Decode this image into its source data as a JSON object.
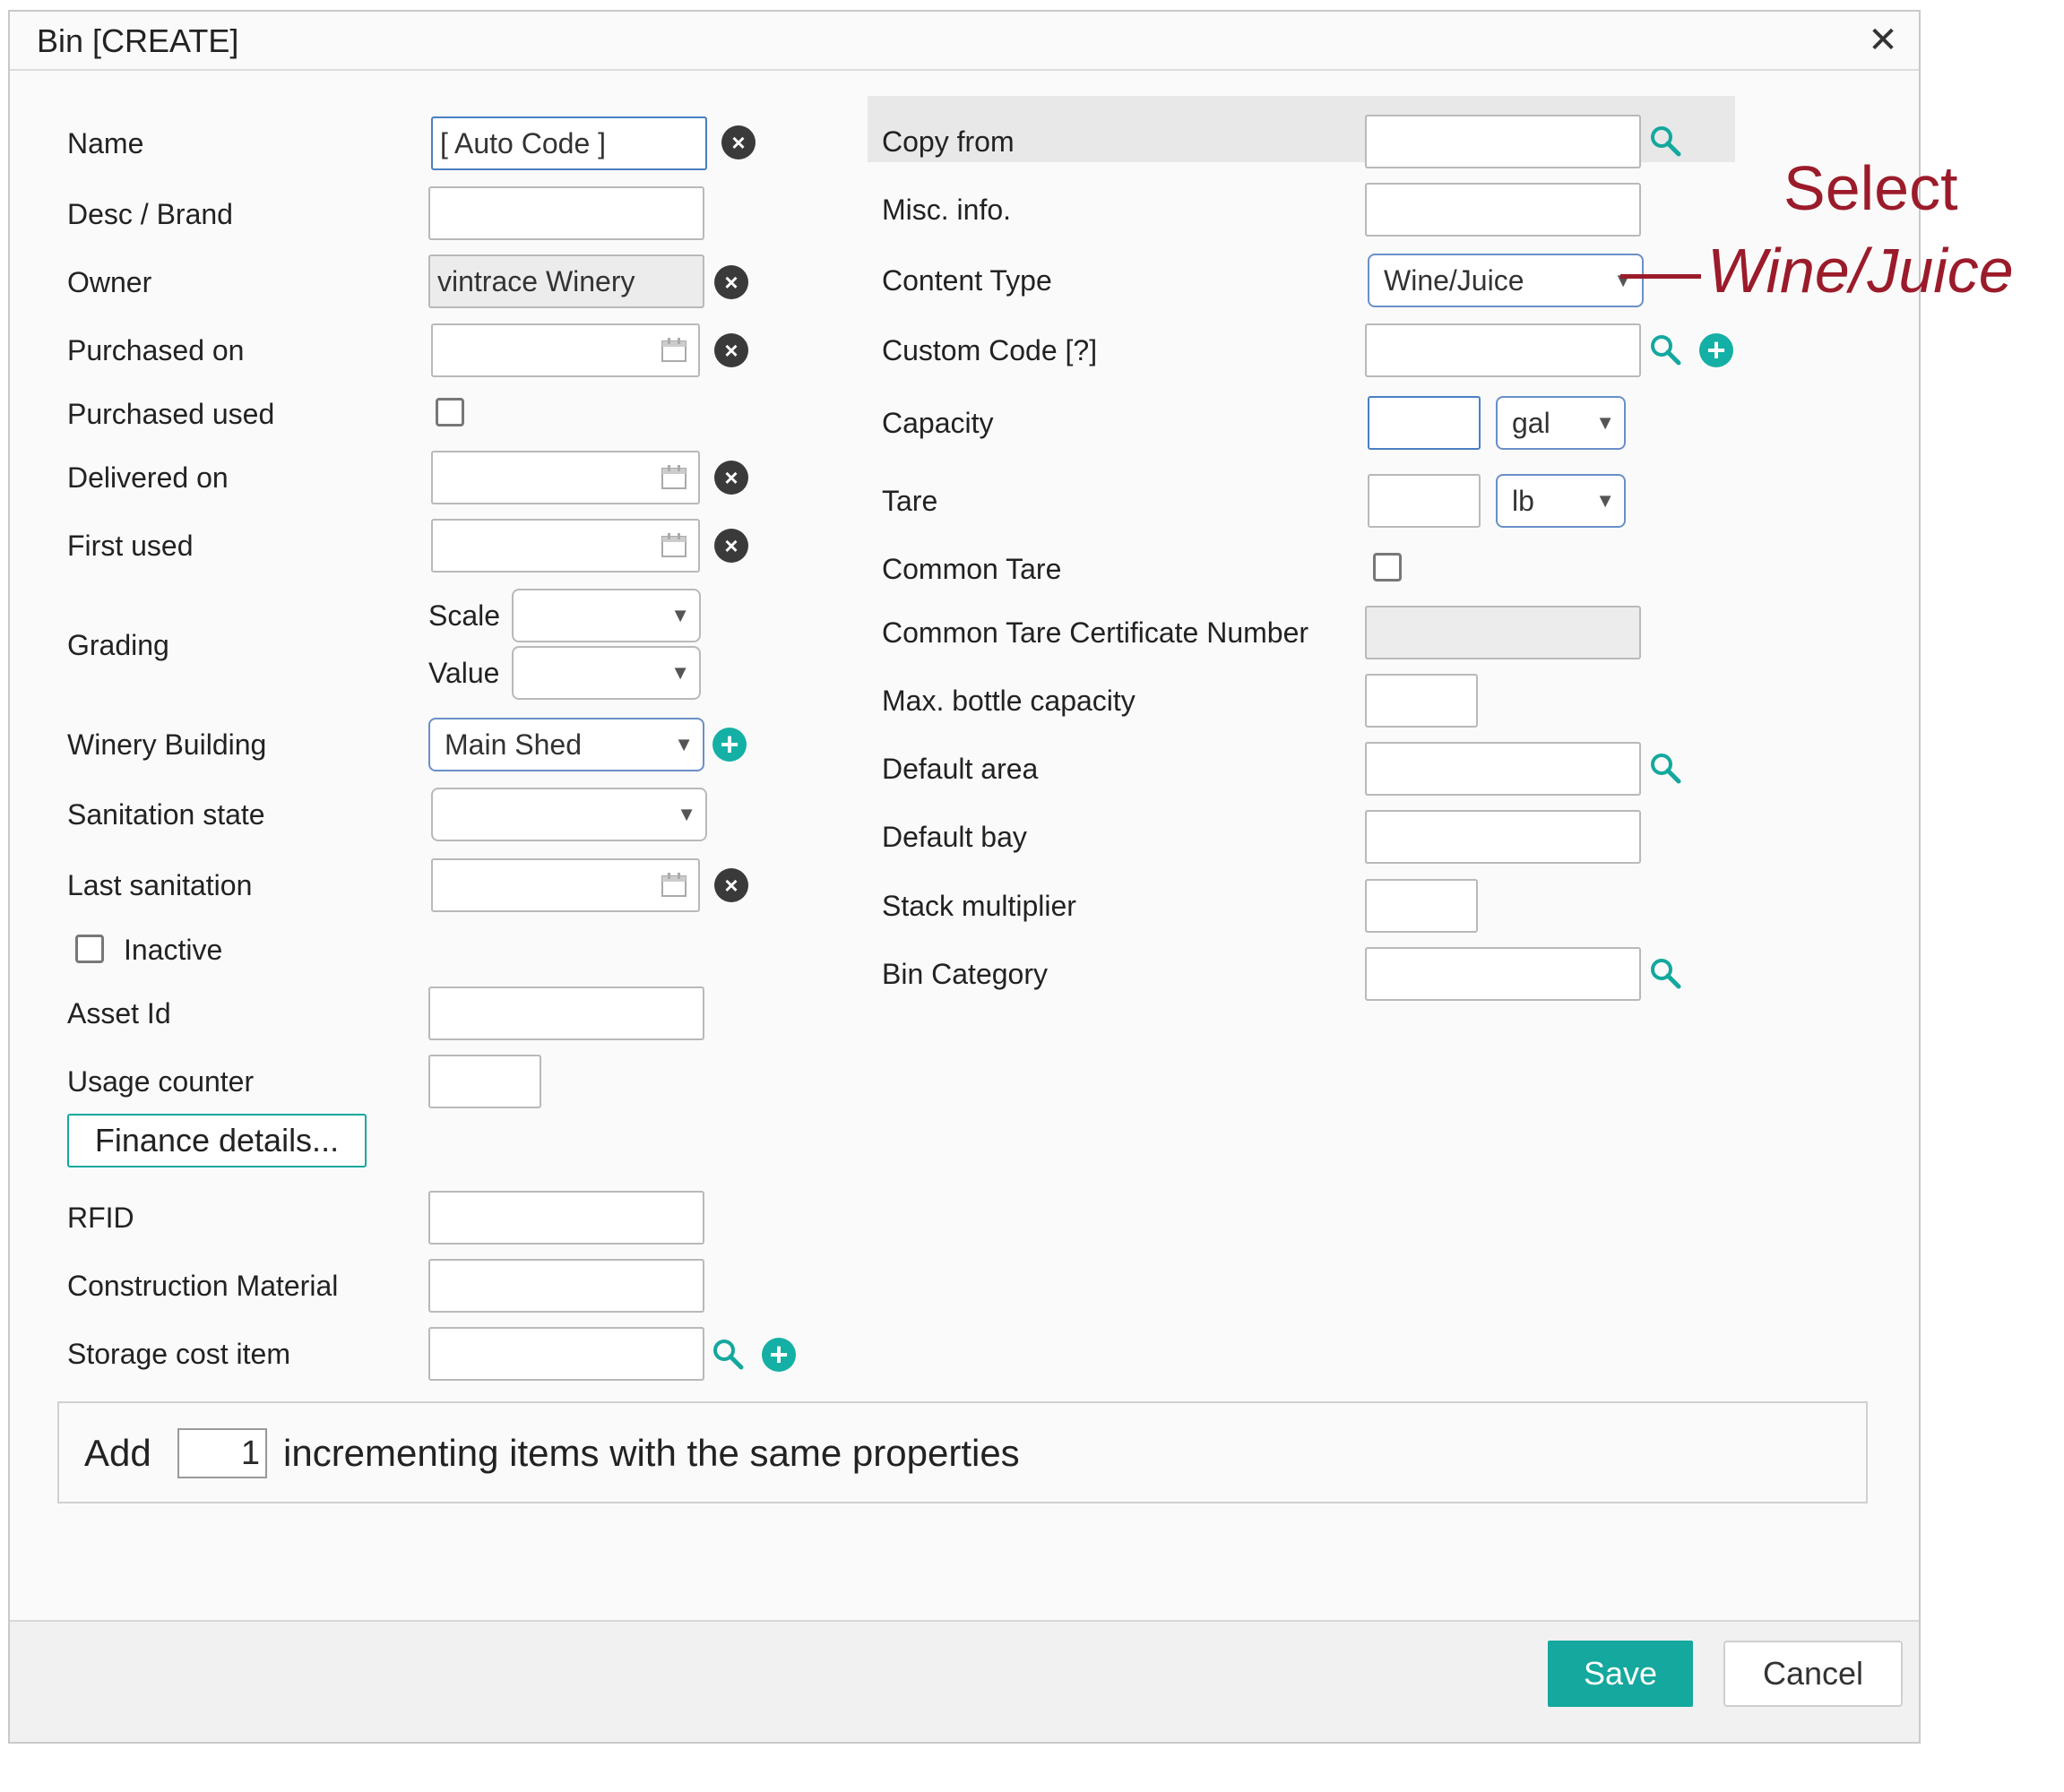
{
  "dialog": {
    "title": "Bin [CREATE]",
    "close_icon": "close-icon"
  },
  "left": {
    "name_label": "Name",
    "name_value": "[ Auto Code ]",
    "desc_label": "Desc / Brand",
    "desc_value": "",
    "owner_label": "Owner",
    "owner_value": "vintrace Winery",
    "purchased_on_label": "Purchased on",
    "purchased_used_label": "Purchased used",
    "delivered_on_label": "Delivered on",
    "first_used_label": "First used",
    "grading_label": "Grading",
    "scale_label": "Scale",
    "value_label": "Value",
    "winery_building_label": "Winery Building",
    "winery_building_value": "Main Shed",
    "sanitation_state_label": "Sanitation state",
    "last_sanitation_label": "Last sanitation",
    "inactive_label": "Inactive",
    "asset_id_label": "Asset Id",
    "usage_counter_label": "Usage counter",
    "finance_button": "Finance details...",
    "rfid_label": "RFID",
    "construction_material_label": "Construction Material",
    "storage_cost_item_label": "Storage cost item"
  },
  "right": {
    "copy_from_label": "Copy from",
    "misc_info_label": "Misc. info.",
    "content_type_label": "Content Type",
    "content_type_value": "Wine/Juice",
    "custom_code_label": "Custom Code [?]",
    "capacity_label": "Capacity",
    "capacity_unit": "gal",
    "tare_label": "Tare",
    "tare_unit": "lb",
    "common_tare_label": "Common Tare",
    "common_tare_cert_label": "Common Tare Certificate Number",
    "max_bottle_label": "Max. bottle capacity",
    "default_area_label": "Default area",
    "default_bay_label": "Default bay",
    "stack_multiplier_label": "Stack multiplier",
    "bin_category_label": "Bin Category"
  },
  "add_items": {
    "prefix": "Add",
    "count": "1",
    "suffix": "incrementing items with the same properties"
  },
  "footer": {
    "save_label": "Save",
    "cancel_label": "Cancel"
  },
  "annotation": {
    "line1": "Select",
    "line2": "Wine/Juice"
  },
  "colors": {
    "accent": "#14a89e",
    "annotation": "#9b1b2a",
    "focus_border": "#4a7fc1"
  }
}
